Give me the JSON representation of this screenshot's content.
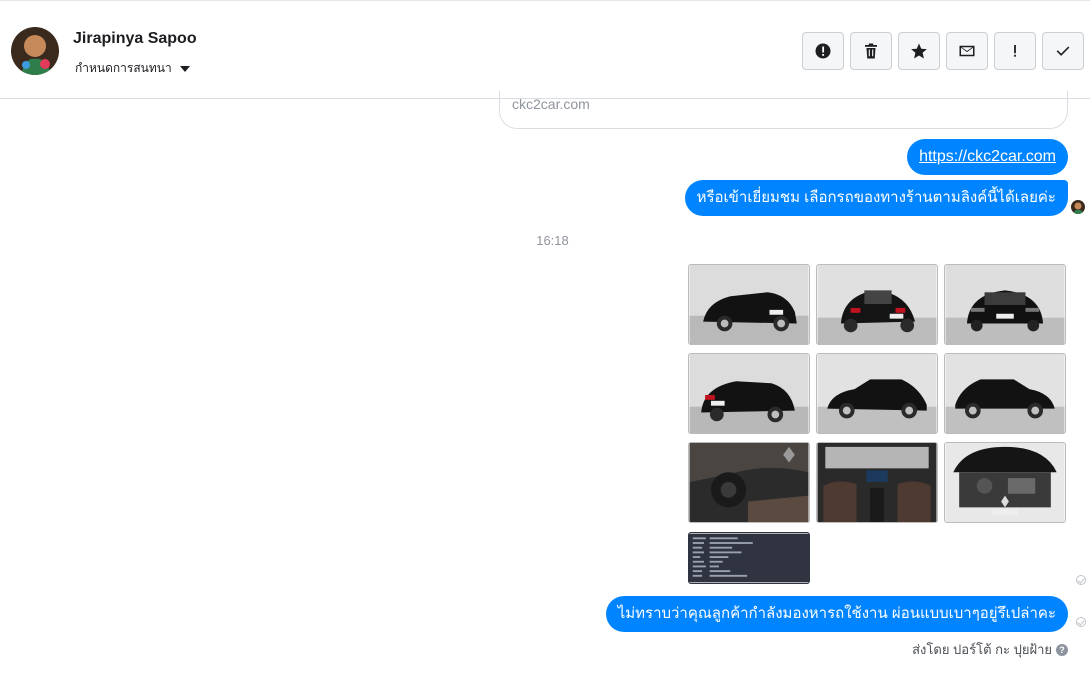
{
  "header": {
    "contact_name": "Jirapinya Sapoo",
    "assign_label": "กำหนดการสนทนา",
    "toolbar": [
      {
        "name": "spam-button",
        "icon": "alert-circle-icon",
        "title": "Spam"
      },
      {
        "name": "delete-button",
        "icon": "trash-icon",
        "title": "Delete"
      },
      {
        "name": "star-button",
        "icon": "star-icon",
        "title": "Star"
      },
      {
        "name": "mark-unread-button",
        "icon": "envelope-icon",
        "title": "Mark as unread"
      },
      {
        "name": "follow-up-button",
        "icon": "exclamation-icon",
        "title": "Follow up"
      },
      {
        "name": "mark-done-button",
        "icon": "checkmark-icon",
        "title": "Mark as done"
      }
    ]
  },
  "chat": {
    "link_preview_domain": "ckc2car.com",
    "messages": {
      "link_message": "https://ckc2car.com",
      "visit_message": "หรือเข้าเยี่ยมชม เลือกรถของทางร้านตามลิงค์นี้ได้เลยค่ะ",
      "question_message": "ไม่ทราบว่าคุณลูกค้ากำลังมองหารถใช้งาน ผ่อนแบบเบาๆอยู่รึเปล่าคะ"
    },
    "timestamp": "16:18",
    "photos": [
      {
        "icon": "car-photo-icon",
        "desc": "front-left"
      },
      {
        "icon": "car-photo-icon",
        "desc": "rear-left"
      },
      {
        "icon": "car-photo-icon",
        "desc": "front"
      },
      {
        "icon": "car-photo-icon",
        "desc": "rear-right"
      },
      {
        "icon": "car-photo-icon",
        "desc": "side-left"
      },
      {
        "icon": "car-photo-icon",
        "desc": "side-right"
      },
      {
        "icon": "car-photo-icon",
        "desc": "interior-dashboard"
      },
      {
        "icon": "car-photo-icon",
        "desc": "interior-cabin"
      },
      {
        "icon": "car-photo-icon",
        "desc": "engine-bay"
      },
      {
        "icon": "spec-sheet-icon",
        "desc": "spec-sheet"
      }
    ],
    "sent_by": "ส่งโดย ปอร์โต้ กะ ปุยฝ้าย"
  },
  "colors": {
    "bubble": "#0084ff",
    "header_border": "#dadde1",
    "button_bg": "#f5f6f7",
    "timestamp": "#90949c"
  }
}
